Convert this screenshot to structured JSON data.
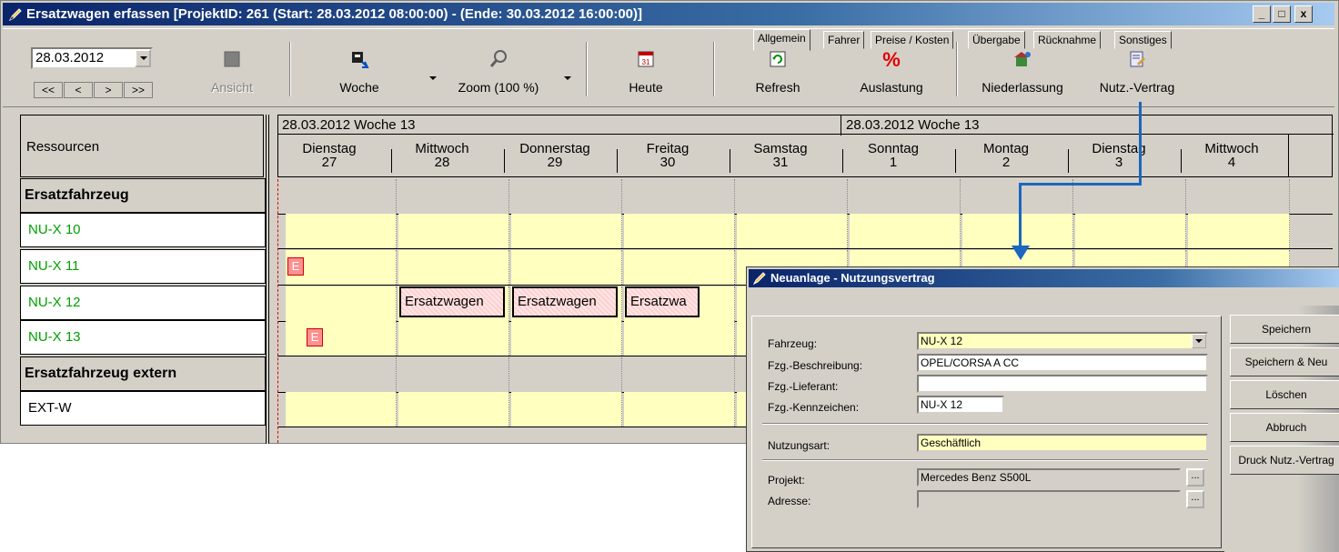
{
  "window": {
    "title": "Ersatzwagen erfassen [ProjektID: 261 (Start: 28.03.2012 08:00:00) - (Ende: 30.03.2012 16:00:00)]",
    "min_label": "_",
    "max_label": "□",
    "close_label": "x"
  },
  "toolbar": {
    "date_value": "28.03.2012",
    "nav": [
      "<<",
      "<",
      ">",
      ">>"
    ],
    "buttons": [
      {
        "label": "Ansicht",
        "icon": "view-icon",
        "enabled": false
      },
      {
        "label": "Woche",
        "icon": "week-icon",
        "enabled": true
      },
      {
        "label": "Zoom (100 %)",
        "icon": "zoom-icon",
        "enabled": true
      },
      {
        "label": "Heute",
        "icon": "today-icon",
        "enabled": true
      },
      {
        "label": "Refresh",
        "icon": "refresh-icon",
        "enabled": true
      },
      {
        "label": "Auslastung",
        "icon": "percent-icon",
        "enabled": true
      },
      {
        "label": "Niederlassung",
        "icon": "branch-icon",
        "enabled": true
      },
      {
        "label": "Nutz.-Vertrag",
        "icon": "contract-icon",
        "enabled": true
      }
    ]
  },
  "planner": {
    "resources_header": "Ressourcen",
    "week_labels": [
      "28.03.2012  Woche 13",
      "28.03.2012  Woche 13"
    ],
    "days": [
      {
        "name": "Dienstag",
        "num": "27"
      },
      {
        "name": "Mittwoch",
        "num": "28"
      },
      {
        "name": "Donnerstag",
        "num": "29"
      },
      {
        "name": "Freitag",
        "num": "30"
      },
      {
        "name": "Samstag",
        "num": "31"
      },
      {
        "name": "Sonntag",
        "num": "1"
      },
      {
        "name": "Montag",
        "num": "2"
      },
      {
        "name": "Dienstag",
        "num": "3"
      },
      {
        "name": "Mittwoch",
        "num": "4"
      }
    ],
    "rows": [
      {
        "label": "Ersatzfahrzeug",
        "type": "group"
      },
      {
        "label": "NU-X 10",
        "type": "item"
      },
      {
        "label": "NU-X 11",
        "type": "item"
      },
      {
        "label": "NU-X 12",
        "type": "item"
      },
      {
        "label": "NU-X 13",
        "type": "item"
      },
      {
        "label": "Ersatzfahrzeug extern",
        "type": "group"
      },
      {
        "label": "EXT-W",
        "type": "ext"
      }
    ],
    "e_marker": "E",
    "bookings": [
      "Ersatzwagen",
      "Ersatzwagen",
      "Ersatzwa"
    ]
  },
  "dialog": {
    "title": "Neuanlage - Nutzungsvertrag",
    "tabs": [
      "Allgemein",
      "Fahrer",
      "Preise / Kosten",
      "Übergabe",
      "Rücknahme",
      "Sonstiges"
    ],
    "fields": {
      "fahrzeug_label": "Fahrzeug:",
      "fahrzeug_value": "NU-X 12",
      "beschreibung_label": "Fzg.-Beschreibung:",
      "beschreibung_value": "OPEL/CORSA A CC",
      "lieferant_label": "Fzg.-Lieferant:",
      "lieferant_value": "",
      "kennzeichen_label": "Fzg.-Kennzeichen:",
      "kennzeichen_value": "NU-X 12",
      "nutzungsart_label": "Nutzungsart:",
      "nutzungsart_value": "Geschäftlich",
      "projekt_label": "Projekt:",
      "projekt_value": "Mercedes Benz S500L",
      "adresse_label": "Adresse:",
      "adresse_value": "",
      "dots": "..."
    },
    "buttons": [
      "Speichern",
      "Speichern & Neu",
      "Löschen",
      "Abbruch",
      "Druck Nutz.-Vertrag"
    ]
  }
}
